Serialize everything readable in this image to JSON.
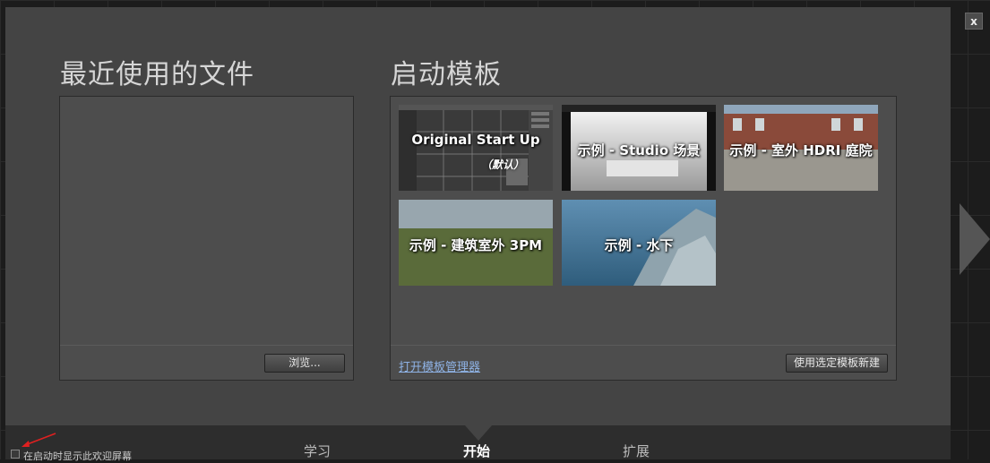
{
  "close_label": "x",
  "recent": {
    "title": "最近使用的文件",
    "browse_label": "浏览..."
  },
  "templates": {
    "title": "启动模板",
    "tiles": [
      {
        "label": "Original Start Up",
        "sublabel": "（默认）"
      },
      {
        "label": "示例 - Studio 场景"
      },
      {
        "label": "示例 - 室外 HDRI 庭院"
      },
      {
        "label": "示例 - 建筑室外 3PM"
      },
      {
        "label": "示例 - 水下"
      }
    ],
    "open_manager_label": "打开模板管理器",
    "new_from_template_label": "使用选定模板新建"
  },
  "bottom": {
    "tabs": [
      "学习",
      "开始",
      "扩展"
    ],
    "active_tab": "开始",
    "startup_checkbox_label": "在启动时显示此欢迎屏幕",
    "startup_checked": false
  },
  "colors": {
    "dialog_bg": "#444444",
    "link": "#8fb3e6",
    "annotation_arrow": "#e02020"
  }
}
